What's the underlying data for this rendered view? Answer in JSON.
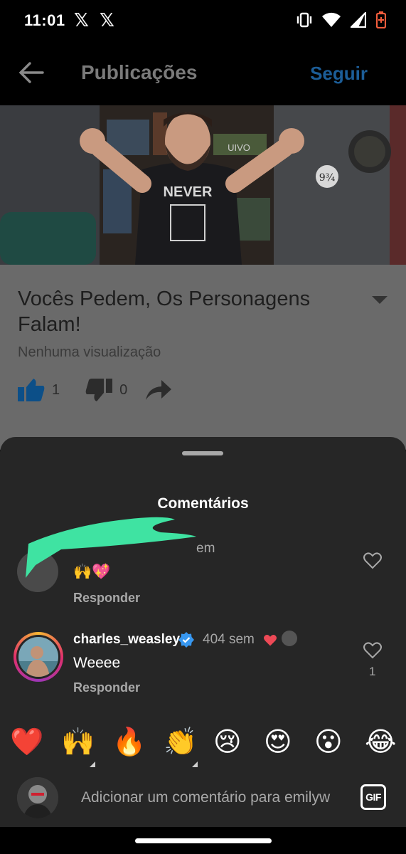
{
  "status_bar": {
    "time": "11:01",
    "x_logo_1": "𝕏",
    "x_logo_2": "𝕏",
    "icons": [
      "vibrate-icon",
      "wifi-icon",
      "signal-icon",
      "battery-low-icon"
    ]
  },
  "header": {
    "title": "Publicações",
    "follow_label": "Seguir",
    "back_icon": "back-arrow-icon"
  },
  "post": {
    "title": "Vocês Pedem, Os Personagens Falam!",
    "views": "Nenhuma visualização",
    "likes": "1",
    "dislikes": "0",
    "shirt_text": "NEVER",
    "shelf_text": "UIVO",
    "platform_sign": "9¾"
  },
  "comments_sheet": {
    "title": "Comentários",
    "comments": [
      {
        "username": "",
        "time": "104 sem",
        "time_visible": "em",
        "text": "🙌💖",
        "reply_label": "Responder",
        "like_count": ""
      },
      {
        "username": "charles_weasley",
        "verified": true,
        "time": "404 sem",
        "text": "Weeee",
        "reply_label": "Responder",
        "like_count": "1"
      }
    ]
  },
  "emoji_bar": [
    "❤️",
    "🙌",
    "🔥",
    "👏",
    "😢",
    "😍",
    "😮",
    "😂"
  ],
  "comment_input": {
    "placeholder": "Adicionar um comentário para emilyw",
    "gif_label": "GIF"
  },
  "colors": {
    "accent": "#1c5d97",
    "sheet_bg": "#262626",
    "verified": "#3797f0",
    "story_ring": "#e1306c"
  }
}
